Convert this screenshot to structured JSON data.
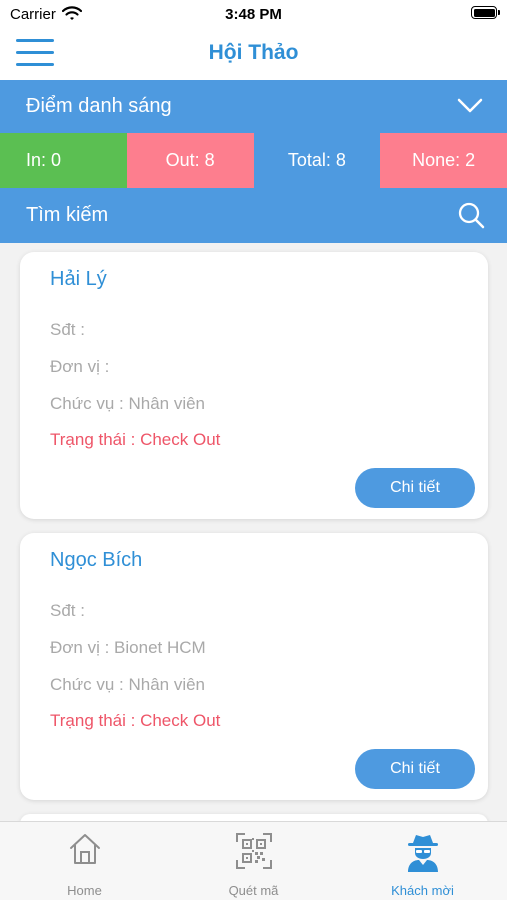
{
  "status_bar": {
    "carrier": "Carrier",
    "time": "3:48 PM"
  },
  "header": {
    "title": "Hội Thảo",
    "menu_icon": "hamburger-menu-icon"
  },
  "session": {
    "selected": "Điểm danh sáng",
    "icon": "chevron-down-icon"
  },
  "stats": {
    "in": "In: 0",
    "out": "Out: 8",
    "total": "Total: 8",
    "none": "None: 2"
  },
  "search": {
    "placeholder": "Tìm kiếm",
    "icon": "search-icon"
  },
  "guests": [
    {
      "name": "Hải Lý",
      "phone": "Sđt :",
      "unit": "Đơn vị :",
      "position": "Chức vụ : Nhân viên",
      "status": "Trạng thái : Check Out",
      "detail_label": "Chi tiết"
    },
    {
      "name": "Ngọc Bích",
      "phone": "Sđt :",
      "unit": "Đơn vị : Bionet HCM",
      "position": "Chức vụ : Nhân viên",
      "status": "Trạng thái : Check Out",
      "detail_label": "Chi tiết"
    }
  ],
  "tabs": [
    {
      "label": "Home",
      "icon": "home-icon",
      "active": false
    },
    {
      "label": "Quét mã",
      "icon": "qr-code-icon",
      "active": false
    },
    {
      "label": "Khách mời",
      "icon": "spy-guest-icon",
      "active": true
    }
  ],
  "colors": {
    "primary": "#4e9ae0",
    "title": "#2f8fd6",
    "in_green": "#5bbf52",
    "out_pink": "#fd7e8e",
    "status_red": "#ee5568",
    "muted_text": "#a9a9a9"
  }
}
